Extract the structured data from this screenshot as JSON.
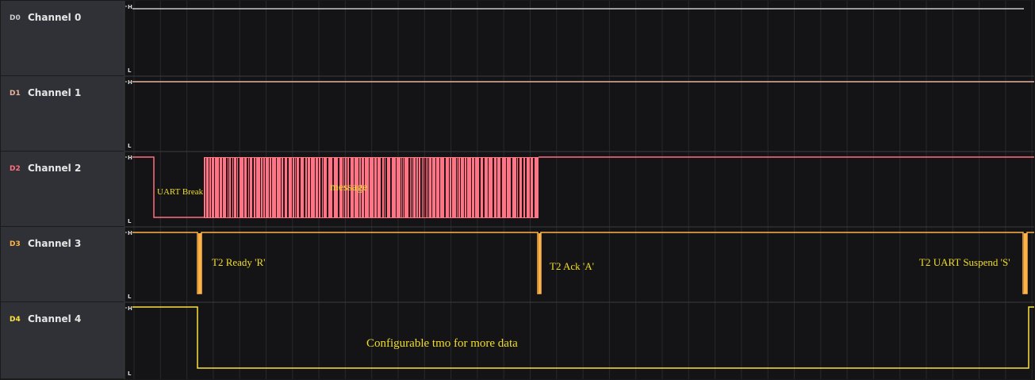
{
  "channels": [
    {
      "tag": "D0",
      "name": "Channel 0",
      "color": "#c8c8c8"
    },
    {
      "tag": "D1",
      "name": "Channel 1",
      "color": "#e6b3a0"
    },
    {
      "tag": "D2",
      "name": "Channel 2",
      "color": "#ff6f7f"
    },
    {
      "tag": "D3",
      "name": "Channel 3",
      "color": "#ffb347"
    },
    {
      "tag": "D4",
      "name": "Channel 4",
      "color": "#ffe23a"
    }
  ],
  "level_labels": {
    "high": "H",
    "low": "L"
  },
  "annotations": {
    "uart_break": "UART Break",
    "message": "message",
    "t2_ready": "T2 Ready 'R'",
    "t2_ack": "T2 Ack 'A'",
    "t2_suspend": "T2 UART Suspend 'S'",
    "tmo": "Configurable tmo for more data"
  },
  "colors": {
    "background": "#141416",
    "label_panel": "#303136",
    "grid": "#2a2b2e",
    "annotation": "#f2de28"
  }
}
